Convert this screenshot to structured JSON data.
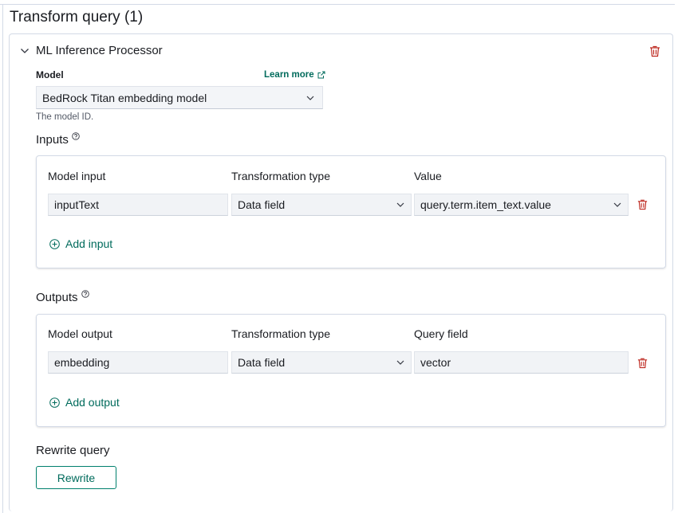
{
  "page_title": "Transform query (1)",
  "processor": {
    "title": "ML Inference Processor",
    "model_label": "Model",
    "learn_more": "Learn more",
    "model_selected": "BedRock Titan embedding model",
    "model_help": "The model ID."
  },
  "inputs": {
    "title": "Inputs",
    "headers": {
      "col1": "Model input",
      "col2": "Transformation type",
      "col3": "Value"
    },
    "rows": [
      {
        "model_field": "inputText",
        "transform": "Data field",
        "value": "query.term.item_text.value"
      }
    ],
    "add_label": "Add input"
  },
  "outputs": {
    "title": "Outputs",
    "headers": {
      "col1": "Model output",
      "col2": "Transformation type",
      "col3": "Query field"
    },
    "rows": [
      {
        "model_field": "embedding",
        "transform": "Data field",
        "value": "vector"
      }
    ],
    "add_label": "Add output"
  },
  "rewrite": {
    "title": "Rewrite query",
    "button_label": "Rewrite"
  },
  "colors": {
    "accent": "#006b5c",
    "danger": "#bd271e",
    "border": "#d3dae6",
    "field_bg": "#f1f3f6"
  }
}
